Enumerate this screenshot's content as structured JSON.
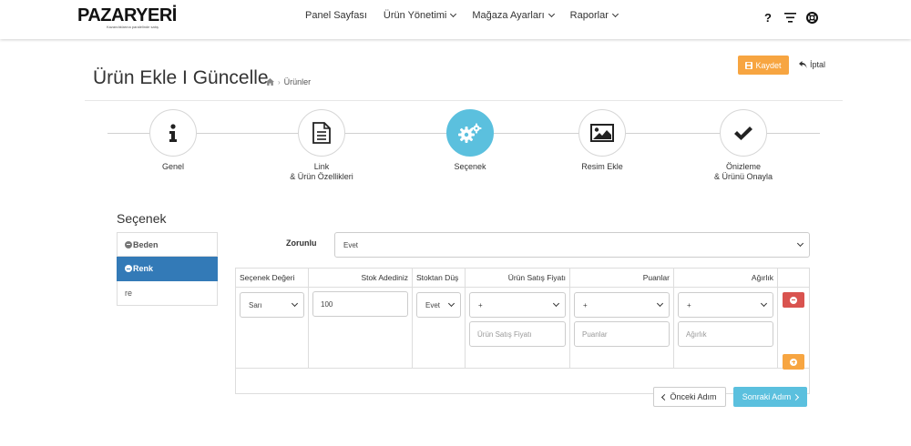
{
  "brand": {
    "name": "PAZARYERİ",
    "tagline": "Kazandıklarına paralelinde satış"
  },
  "nav": {
    "items": [
      {
        "label": "Panel Sayfası",
        "has_dropdown": false
      },
      {
        "label": "Ürün Yönetimi",
        "has_dropdown": true
      },
      {
        "label": "Mağaza Ayarları",
        "has_dropdown": true
      },
      {
        "label": "Raporlar",
        "has_dropdown": true
      }
    ],
    "icons": [
      "help-icon",
      "filter-icon",
      "support-icon"
    ],
    "help_glyph": "?"
  },
  "header": {
    "title": "Ürün Ekle I Güncelle",
    "breadcrumb": "Ürünler",
    "save_label": "Kaydet",
    "cancel_label": "İptal"
  },
  "steps": [
    {
      "label1": "Genel",
      "label2": "",
      "icon": "info-icon",
      "active": false
    },
    {
      "label1": "Link",
      "label2": "& Ürün Özellikleri",
      "icon": "document-icon",
      "active": false
    },
    {
      "label1": "Seçenek",
      "label2": "",
      "icon": "gears-icon",
      "active": true
    },
    {
      "label1": "Resim Ekle",
      "label2": "",
      "icon": "image-icon",
      "active": false
    },
    {
      "label1": "Önizleme",
      "label2": "& Ürünü Onayla",
      "icon": "check-icon",
      "active": false
    }
  ],
  "section": {
    "title": "Seçenek",
    "options": [
      {
        "label": "Beden",
        "state": "normal"
      },
      {
        "label": "Renk",
        "state": "active"
      },
      {
        "label": "re",
        "state": "plain"
      }
    ]
  },
  "form": {
    "required_label": "Zorunlu",
    "required_value": "Evet",
    "columns": [
      "Seçenek Değeri",
      "Stok Adediniz",
      "Stoktan Düş",
      "Ürün Satış Fiyatı",
      "Puanlar",
      "Ağırlık",
      ""
    ],
    "row": {
      "option_value": "Sarı",
      "stock": "100",
      "subtract": "Evet",
      "price_sign": "+",
      "price_placeholder": "Ürün Satış Fiyatı",
      "points_sign": "+",
      "points_placeholder": "Puanlar",
      "weight_sign": "+",
      "weight_placeholder": "Ağırlık"
    }
  },
  "footer": {
    "prev_label": "Önceki Adım",
    "next_label": "Sonraki Adım"
  },
  "colors": {
    "primary": "#337ab7",
    "info": "#5bc0de",
    "warning": "#f7a541",
    "danger": "#d9534f"
  }
}
